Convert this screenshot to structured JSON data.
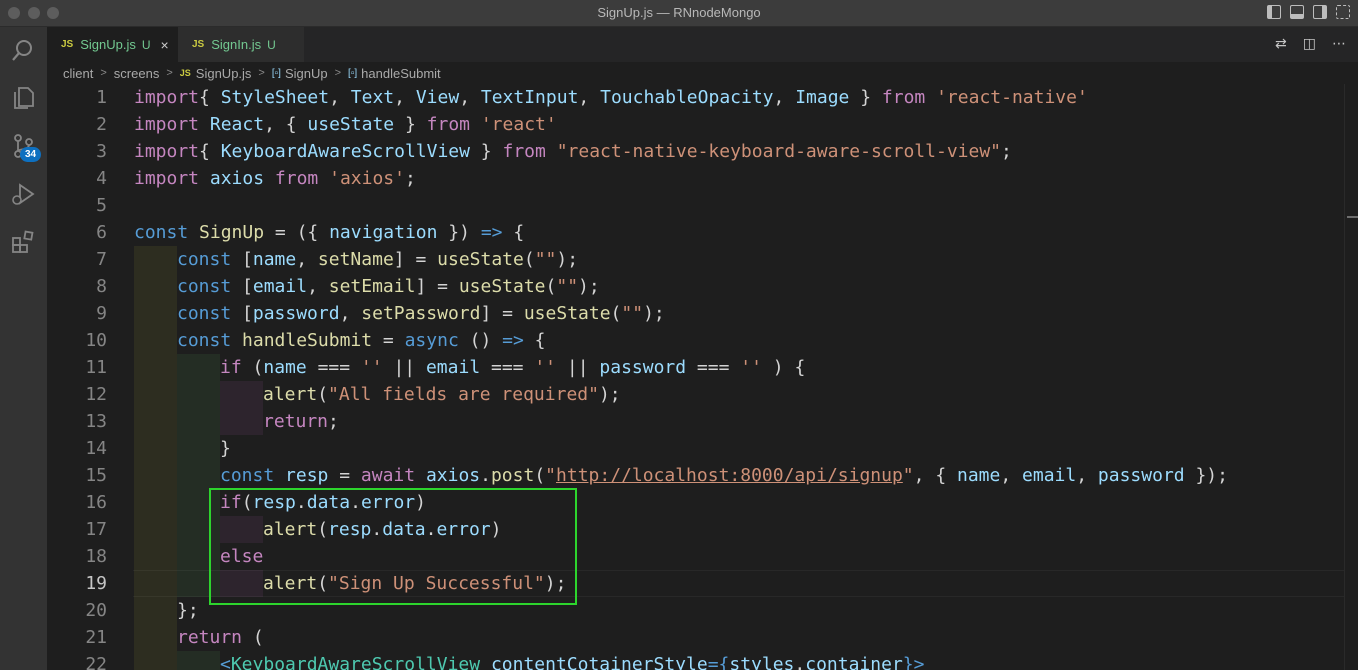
{
  "window": {
    "title": "SignUp.js — RNnodeMongo"
  },
  "activity_bar": {
    "scm_badge": "34"
  },
  "tabs": [
    {
      "lang": "JS",
      "name": "SignUp.js",
      "status": "U",
      "close": "×"
    },
    {
      "lang": "JS",
      "name": "SignIn.js",
      "status": "U"
    }
  ],
  "breadcrumb": {
    "items": [
      "client",
      "screens",
      "SignUp.js",
      "SignUp",
      "handleSubmit"
    ],
    "file_lang": "JS",
    "separator": ">"
  },
  "editor": {
    "current_line": 19,
    "lines": [
      {
        "n": "1",
        "tokens": [
          [
            "kw2",
            "import"
          ],
          [
            "",
            "{ "
          ],
          [
            "var",
            "StyleSheet"
          ],
          [
            "",
            ", "
          ],
          [
            "var",
            "Text"
          ],
          [
            "",
            ", "
          ],
          [
            "var",
            "View"
          ],
          [
            "",
            ", "
          ],
          [
            "var",
            "TextInput"
          ],
          [
            "",
            ", "
          ],
          [
            "var",
            "TouchableOpacity"
          ],
          [
            "",
            ", "
          ],
          [
            "var",
            "Image"
          ],
          [
            "",
            " } "
          ],
          [
            "kw2",
            "from"
          ],
          [
            "",
            " "
          ],
          [
            "str",
            "'react-native'"
          ]
        ]
      },
      {
        "n": "2",
        "tokens": [
          [
            "kw2",
            "import"
          ],
          [
            "",
            " "
          ],
          [
            "var",
            "React"
          ],
          [
            "",
            ", { "
          ],
          [
            "var",
            "useState"
          ],
          [
            "",
            " } "
          ],
          [
            "kw2",
            "from"
          ],
          [
            "",
            " "
          ],
          [
            "str",
            "'react'"
          ]
        ]
      },
      {
        "n": "3",
        "tokens": [
          [
            "kw2",
            "import"
          ],
          [
            "",
            "{ "
          ],
          [
            "var",
            "KeyboardAwareScrollView"
          ],
          [
            "",
            " } "
          ],
          [
            "kw2",
            "from"
          ],
          [
            "",
            " "
          ],
          [
            "str",
            "\"react-native-keyboard-aware-scroll-view\""
          ],
          [
            "",
            ";"
          ]
        ]
      },
      {
        "n": "4",
        "tokens": [
          [
            "kw2",
            "import"
          ],
          [
            "",
            " "
          ],
          [
            "var",
            "axios"
          ],
          [
            "",
            " "
          ],
          [
            "kw2",
            "from"
          ],
          [
            "",
            " "
          ],
          [
            "str",
            "'axios'"
          ],
          [
            "",
            ";"
          ]
        ]
      },
      {
        "n": "5",
        "tokens": []
      },
      {
        "n": "6",
        "tokens": [
          [
            "kw",
            "const"
          ],
          [
            "",
            " "
          ],
          [
            "fn",
            "SignUp"
          ],
          [
            "",
            " = ({ "
          ],
          [
            "var",
            "navigation"
          ],
          [
            "",
            " }) "
          ],
          [
            "kw",
            "=>"
          ],
          [
            "",
            " {"
          ]
        ]
      },
      {
        "n": "7",
        "tokens": [
          [
            "kw",
            "const"
          ],
          [
            "",
            " ["
          ],
          [
            "var",
            "name"
          ],
          [
            "",
            ", "
          ],
          [
            "fn",
            "setName"
          ],
          [
            "",
            "] = "
          ],
          [
            "fn",
            "useState"
          ],
          [
            "",
            "("
          ],
          [
            "str",
            "\"\""
          ],
          [
            "",
            ");"
          ]
        ]
      },
      {
        "n": "8",
        "tokens": [
          [
            "kw",
            "const"
          ],
          [
            "",
            " ["
          ],
          [
            "var",
            "email"
          ],
          [
            "",
            ", "
          ],
          [
            "fn",
            "setEmail"
          ],
          [
            "",
            "] = "
          ],
          [
            "fn",
            "useState"
          ],
          [
            "",
            "("
          ],
          [
            "str",
            "\"\""
          ],
          [
            "",
            ");"
          ]
        ]
      },
      {
        "n": "9",
        "tokens": [
          [
            "kw",
            "const"
          ],
          [
            "",
            " ["
          ],
          [
            "var",
            "password"
          ],
          [
            "",
            ", "
          ],
          [
            "fn",
            "setPassword"
          ],
          [
            "",
            "] = "
          ],
          [
            "fn",
            "useState"
          ],
          [
            "",
            "("
          ],
          [
            "str",
            "\"\""
          ],
          [
            "",
            ");"
          ]
        ]
      },
      {
        "n": "10",
        "tokens": [
          [
            "kw",
            "const"
          ],
          [
            "",
            " "
          ],
          [
            "fn",
            "handleSubmit"
          ],
          [
            "",
            " = "
          ],
          [
            "kw",
            "async"
          ],
          [
            "",
            " () "
          ],
          [
            "kw",
            "=>"
          ],
          [
            "",
            " {"
          ]
        ]
      },
      {
        "n": "11",
        "tokens": [
          [
            "kw2",
            "if"
          ],
          [
            "",
            " ("
          ],
          [
            "var",
            "name"
          ],
          [
            "",
            " === "
          ],
          [
            "str",
            "''"
          ],
          [
            "",
            " || "
          ],
          [
            "var",
            "email"
          ],
          [
            "",
            " === "
          ],
          [
            "str",
            "''"
          ],
          [
            "",
            " || "
          ],
          [
            "var",
            "password"
          ],
          [
            "",
            " === "
          ],
          [
            "str",
            "''"
          ],
          [
            "",
            " ) {"
          ]
        ]
      },
      {
        "n": "12",
        "tokens": [
          [
            "fn",
            "alert"
          ],
          [
            "",
            "("
          ],
          [
            "str",
            "\"All fields are required\""
          ],
          [
            "",
            ");"
          ]
        ]
      },
      {
        "n": "13",
        "tokens": [
          [
            "kw2",
            "return"
          ],
          [
            "",
            ";"
          ]
        ]
      },
      {
        "n": "14",
        "tokens": [
          [
            "",
            "}"
          ]
        ]
      },
      {
        "n": "15",
        "tokens": [
          [
            "kw",
            "const"
          ],
          [
            "",
            " "
          ],
          [
            "var",
            "resp"
          ],
          [
            "",
            " = "
          ],
          [
            "kw2",
            "await"
          ],
          [
            "",
            " "
          ],
          [
            "var",
            "axios"
          ],
          [
            "",
            "."
          ],
          [
            "fn",
            "post"
          ],
          [
            "",
            "("
          ],
          [
            "str",
            "\""
          ],
          [
            "str url",
            "http://localhost:8000/api/signup"
          ],
          [
            "str",
            "\""
          ],
          [
            "",
            ", { "
          ],
          [
            "var",
            "name"
          ],
          [
            "",
            ", "
          ],
          [
            "var",
            "email"
          ],
          [
            "",
            ", "
          ],
          [
            "var",
            "password"
          ],
          [
            "",
            " });"
          ]
        ]
      },
      {
        "n": "16",
        "tokens": [
          [
            "kw2",
            "if"
          ],
          [
            "",
            "("
          ],
          [
            "var",
            "resp"
          ],
          [
            "",
            "."
          ],
          [
            "var",
            "data"
          ],
          [
            "",
            "."
          ],
          [
            "var",
            "error"
          ],
          [
            "",
            ")"
          ]
        ]
      },
      {
        "n": "17",
        "tokens": [
          [
            "fn",
            "alert"
          ],
          [
            "",
            "("
          ],
          [
            "var",
            "resp"
          ],
          [
            "",
            "."
          ],
          [
            "var",
            "data"
          ],
          [
            "",
            "."
          ],
          [
            "var",
            "error"
          ],
          [
            "",
            ")"
          ]
        ]
      },
      {
        "n": "18",
        "tokens": [
          [
            "kw2",
            "else"
          ]
        ]
      },
      {
        "n": "19",
        "tokens": [
          [
            "fn",
            "alert"
          ],
          [
            "",
            "("
          ],
          [
            "str",
            "\"Sign Up Successful\""
          ],
          [
            "",
            ");"
          ]
        ]
      },
      {
        "n": "20",
        "tokens": [
          [
            "",
            "};"
          ]
        ]
      },
      {
        "n": "21",
        "tokens": [
          [
            "kw2",
            "return"
          ],
          [
            "",
            " ("
          ]
        ]
      },
      {
        "n": "22",
        "tokens": [
          [
            "kw",
            "<"
          ],
          [
            "cls",
            "KeyboardAwareScrollView"
          ],
          [
            "",
            " "
          ],
          [
            "var",
            "contentCotainerStyle"
          ],
          [
            "kw",
            "={"
          ],
          [
            "var",
            "styles"
          ],
          [
            "",
            "."
          ],
          [
            "var",
            "container"
          ],
          [
            "kw",
            "}"
          ],
          [
            "kw",
            ">"
          ]
        ]
      }
    ]
  }
}
